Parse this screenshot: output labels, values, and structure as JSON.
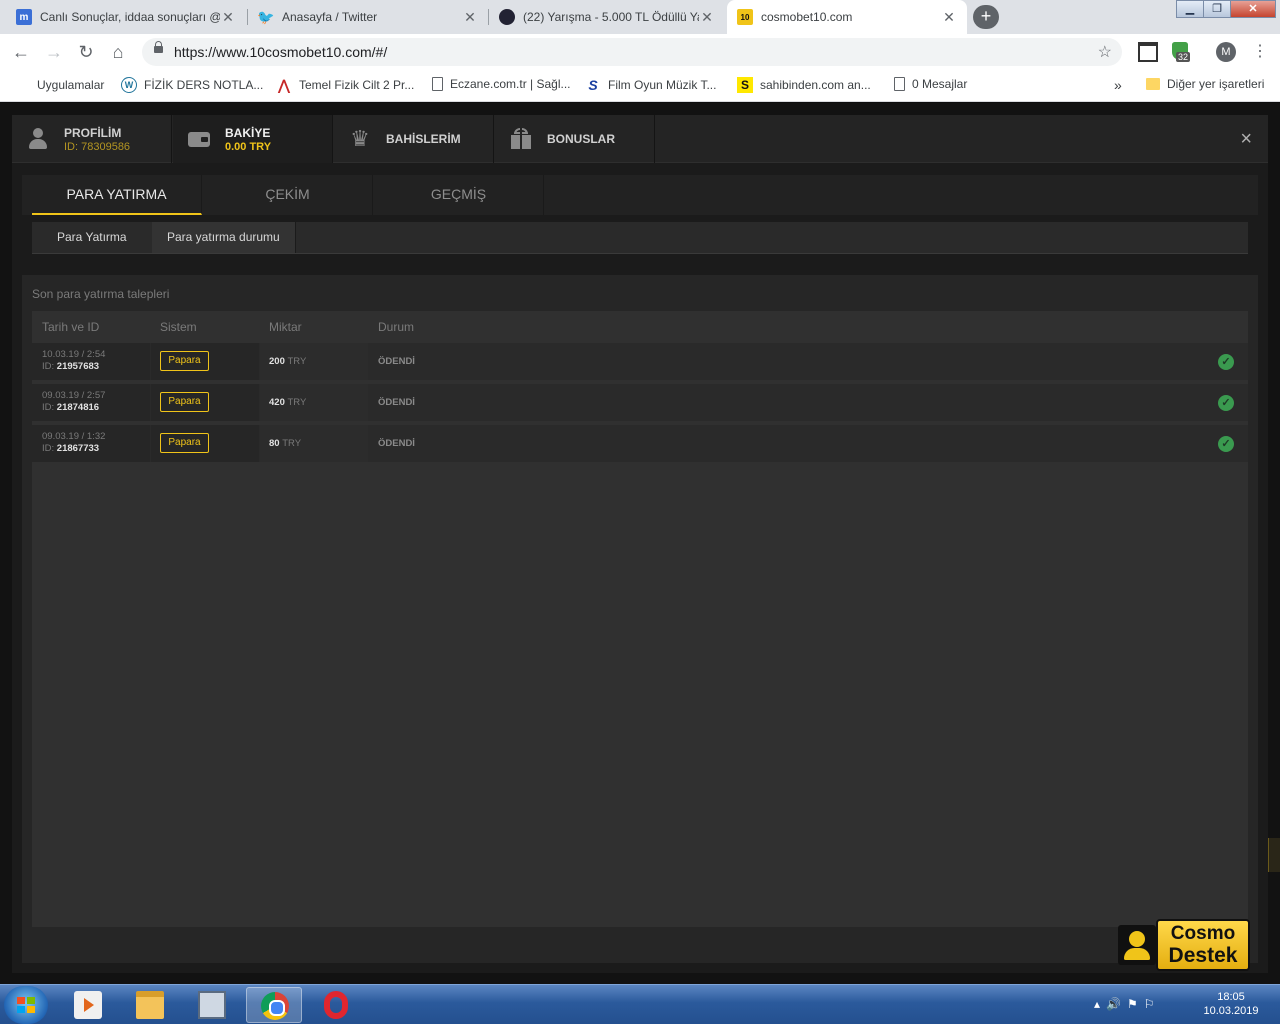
{
  "browser": {
    "tabs": [
      {
        "title": "Canlı Sonuçlar, iddaa sonuçları @",
        "favicon": "m",
        "favicon_color": "#3b6fd6"
      },
      {
        "title": "Anasayfa / Twitter",
        "favicon": "twitter",
        "favicon_color": "#1da1f2"
      },
      {
        "title": "(22) Yarışma - 5.000 TL Ödüllü Ya",
        "favicon": "circle",
        "favicon_color": "#222233"
      },
      {
        "title": "cosmobet10.com",
        "favicon": "10",
        "favicon_color": "#f0c419"
      }
    ],
    "active_tab": 3,
    "url": "https://www.10cosmobet10.com/#/",
    "extension_badge": "32",
    "profile_initial": "M",
    "bookmarks": [
      {
        "label": "Uygulamalar",
        "icon": "apps-icon"
      },
      {
        "label": "FİZİK DERS NOTLA...",
        "icon": "wordpress-icon"
      },
      {
        "label": "Temel Fizik Cilt 2 Pr...",
        "icon": "caret-icon"
      },
      {
        "label": "Eczane.com.tr | Sağl...",
        "icon": "page-icon"
      },
      {
        "label": "Film Oyun Müzik T...",
        "icon": "s-icon"
      },
      {
        "label": "sahibinden.com an...",
        "icon": "sahibinden-icon"
      },
      {
        "label": "0 Mesajlar",
        "icon": "page-icon"
      }
    ],
    "bookmarks_overflow": "»",
    "other_bookmarks": "Diğer yer işaretleri"
  },
  "account_modal": {
    "tabs": [
      {
        "label": "PROFİLİM",
        "sub": "ID: 78309586",
        "icon": "user-icon"
      },
      {
        "label": "BAKİYE",
        "sub": "0.00 TRY",
        "icon": "wallet-icon"
      },
      {
        "label": "BAHİSLERİM",
        "sub": "",
        "icon": "trophy-icon"
      },
      {
        "label": "BONUSLAR",
        "sub": "",
        "icon": "gift-icon"
      }
    ],
    "active_tab": 1,
    "close": "×",
    "subtabs": [
      "PARA YATIRMA",
      "ÇEKİM",
      "GEÇMİŞ"
    ],
    "active_subtab": 0,
    "subsubtabs": [
      "Para Yatırma",
      "Para yatırma durumu"
    ],
    "active_subsubtab": 1,
    "panel_title": "Son para yatırma talepleri",
    "columns": [
      "Tarih ve ID",
      "Sistem",
      "Miktar",
      "Durum"
    ],
    "rows": [
      {
        "date": "10.03.19 / 2:54",
        "id_label": "ID:",
        "id": "21957683",
        "system": "Papara",
        "amount": "200",
        "currency": "TRY",
        "status": "ÖDENDİ"
      },
      {
        "date": "09.03.19 / 2:57",
        "id_label": "ID:",
        "id": "21874816",
        "system": "Papara",
        "amount": "420",
        "currency": "TRY",
        "status": "ÖDENDİ"
      },
      {
        "date": "09.03.19 / 1:32",
        "id_label": "ID:",
        "id": "21867733",
        "system": "Papara",
        "amount": "80",
        "currency": "TRY",
        "status": "ÖDENDİ"
      }
    ],
    "status_icon": "check-circle-icon"
  },
  "support_widget": {
    "line1": "Cosmo",
    "line2": "Destek"
  },
  "taskbar": {
    "time": "18:05",
    "date": "10.03.2019",
    "apps": [
      "media-player-icon",
      "file-explorer-icon",
      "network-window-icon",
      "chrome-icon",
      "opera-icon"
    ],
    "active_app": 3
  },
  "colors": {
    "accent": "#f0c419",
    "success": "#3a9a4f",
    "panel": "#262626"
  }
}
